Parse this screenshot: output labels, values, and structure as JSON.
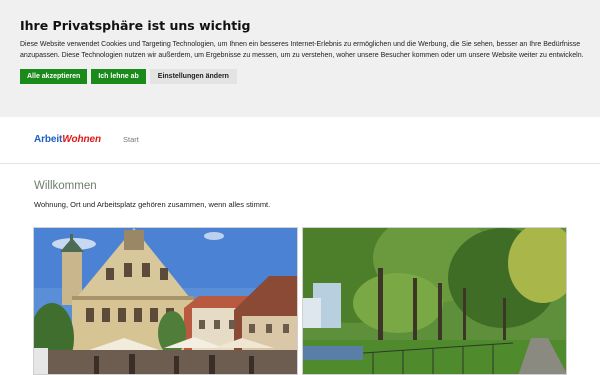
{
  "cookie_banner": {
    "title": "Ihre Privatsphäre ist uns wichtig",
    "text": "Diese Website verwendet Cookies und Targeting Technologien, um Ihnen ein besseres Internet-Erlebnis zu ermöglichen und die Werbung, die Sie sehen, besser an Ihre Bedürfnisse anzupassen. Diese Technologien nutzen wir außerdem, um Ergebnisse zu messen, um zu verstehen, woher unsere Besucher kommen oder um unsere Website weiter zu entwickeln.",
    "accept_label": "Alle akzeptieren",
    "reject_label": "Ich lehne ab",
    "settings_label": "Einstellungen ändern"
  },
  "nav": {
    "logo_part1": "Arbeit",
    "logo_part2": "Wohnen",
    "links": [
      "Start"
    ]
  },
  "main": {
    "title": "Willkommen",
    "lead": "Wohnung, Ort und Arbeitsplatz gehören zusammen, wenn alles stimmt."
  },
  "colors": {
    "accept_green": "#1a8a1a",
    "logo_blue": "#1e5fc4",
    "logo_red": "#d91a1a"
  }
}
